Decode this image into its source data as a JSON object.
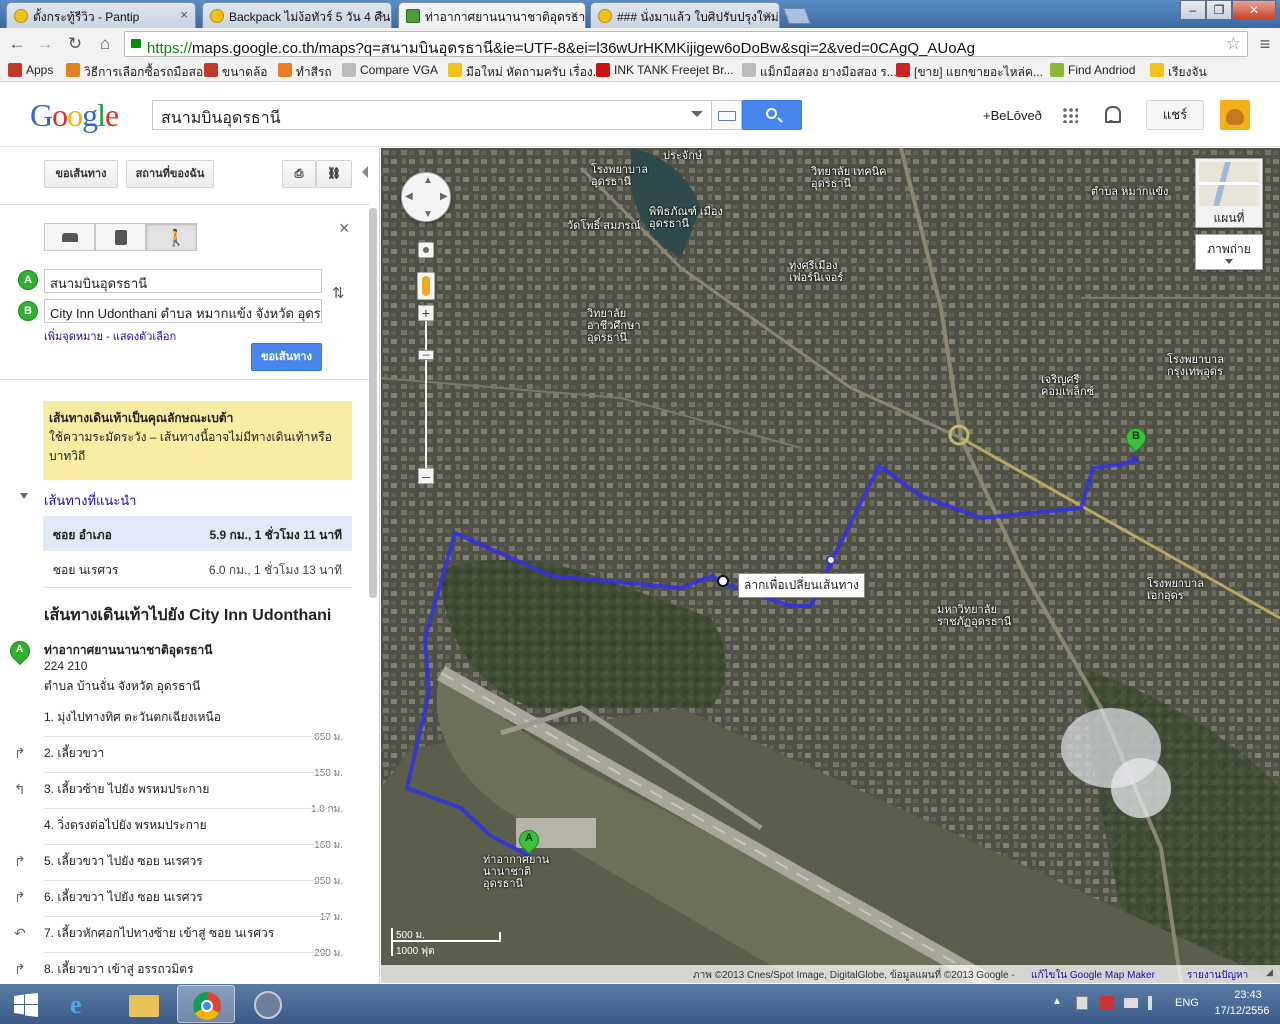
{
  "browser": {
    "tabs": [
      {
        "title": "ตั้งกระทู้รีวิว - Pantip"
      },
      {
        "title": "Backpack ไม่ง้อทัวร์ 5 วัน 4 คืน"
      },
      {
        "title": "ท่าอากาศยานนานาชาติอุดรธานี"
      },
      {
        "title": "### นั่งมาแล้ว ใบศิปรับปรุงใหม่"
      }
    ],
    "url_https": "https://",
    "url_rest": "maps.google.co.th/maps?q=สนามบินอุดรธานี&ie=UTF-8&ei=l36wUrHKMKijigew6oDoBw&sqi=2&ved=0CAgQ_AUoAg",
    "bookmarks": [
      {
        "label": "Apps",
        "color": "#c0392b"
      },
      {
        "label": "วิธีการเลือกซื้อรถมือสอง",
        "color": "#e67e22"
      },
      {
        "label": "ขนาดล้อ",
        "color": "#c0392b"
      },
      {
        "label": "ทำสีรถ",
        "color": "#e67e22"
      },
      {
        "label": "Compare VGA",
        "color": "#bbbbbb"
      },
      {
        "label": "มือใหม่ หัดถามครับ เรื่อง..",
        "color": "#f2c21a"
      },
      {
        "label": "INK TANK Freejet Br...",
        "color": "#cc1111"
      },
      {
        "label": "แม็กมือสอง ยางมือสอง ร...",
        "color": "#bbbbbb"
      },
      {
        "label": "[ขาย] แยกขายอะไหล่ค...",
        "color": "#cc2222"
      },
      {
        "label": "Find Andriod",
        "color": "#88bb33"
      },
      {
        "label": "เรียงจัน",
        "color": "#f2c21a"
      }
    ]
  },
  "header": {
    "logo": "Google",
    "search_value": "สนามบินอุดรธานี",
    "plus_user": "+BeLōveð",
    "share": "แชร์"
  },
  "panel": {
    "get_directions": "ขอเส้นทาง",
    "my_places": "สถานที่ของฉัน",
    "origin": "สนามบินอุดรธานี",
    "destination": "City Inn Udonthani ตำบล หมากแข้ง จังหวัด อุดรธานี",
    "add_dest": "เพิ่มจุดหมาย - แสดงตัวเลือก",
    "submit": "ขอเส้นทาง",
    "warn_title": "เส้นทางเดินเท้าเป็นคุณลักษณะเบต้า",
    "warn_body": "ใช้ความระมัดระวัง – เส้นทางนี้อาจไม่มีทางเดินเท้าหรือบาทวิถี",
    "suggested": "เส้นทางที่แนะนำ",
    "routes": [
      {
        "name": "ซอย อำเภอ",
        "info": "5.9 กม., 1 ชั่วโมง 11 นาที"
      },
      {
        "name": "ซอย นเรศวร",
        "info": "6.0 กม., 1 ชั่วโมง 13 นาที"
      }
    ],
    "walk_title": "เส้นทางเดินเท้าไปยัง City Inn Udonthani",
    "start_name": "ท่าอากาศยานนานาชาติอุดรธานี",
    "start_addr1": "224 210",
    "start_addr2": "ตำบล บ้านจั่น จังหวัด อุดรธานี",
    "steps": [
      {
        "text": "1. มุ่งไปทางทิศ ตะวันตกเฉียงเหนือ",
        "dist": "650 ม."
      },
      {
        "text": "2. เลี้ยวขวา",
        "dist": "150 ม."
      },
      {
        "text": "3. เลี้ยวซ้าย ไปยัง พรหมประกาย",
        "dist": "1.0 กม."
      },
      {
        "text": "4. วิ่งตรงต่อไปยัง พรหมประกาย",
        "dist": "160 ม."
      },
      {
        "text": "5. เลี้ยวขวา ไปยัง ซอย นเรศวร",
        "dist": "950 ม."
      },
      {
        "text": "6. เลี้ยวขวา ไปยัง ซอย นเรศวร",
        "dist": "17 ม."
      },
      {
        "text": "7. เลี้ยวหักศอกไปทางซ้าย เข้าสู่ ซอย นเรศวร",
        "dist": "290 ม."
      },
      {
        "text": "8. เลี้ยวขวา เข้าสู่ อรรถวมิตร",
        "dist": ""
      }
    ]
  },
  "map": {
    "drag_tip": "ลากเพื่อเปลี่ยนเส้นทาง",
    "map_label": "แผนที่",
    "sat_label": "ภาพถ่าย",
    "scale_m": "500 ม.",
    "scale_ft": "1000 ฟุต",
    "labels": [
      {
        "text": "ประจักษ์"
      },
      {
        "text": "โรงพยาบาล อุดรธานี"
      },
      {
        "text": "วิทยาลัย เทคนิคอุดรธานี"
      },
      {
        "text": "พิพิธภัณฑ์ เมืองอุดรธานี"
      },
      {
        "text": "วัดโพธิ์ สมภรณ์"
      },
      {
        "text": "ทุ่งศรีเมือง เฟอร์นิเจอร์"
      },
      {
        "text": "วิทยาลัย อาชีวศึกษา อุดรธานี"
      },
      {
        "text": "ตำบล หมากแข้ง"
      },
      {
        "text": "โรงพยาบาล กรุงเทพอุดร"
      },
      {
        "text": "เจริญศรี คอมเพล็กซ์"
      },
      {
        "text": "มหาวิทยาลัย ราชภัฏอุดรธานี"
      },
      {
        "text": "โรงพยาบาล เอกอุดร"
      },
      {
        "text": "ท่าอากาศยาน นานาชาติอุดรธานี"
      }
    ],
    "marker_a": "A",
    "marker_b": "B",
    "attribution": "ภาพ ©2013 Cnes/Spot Image, DigitalGlobe, ข้อมูลแผนที่ ©2013 Google -",
    "edit_link": "แก้ไขใน Google Map Maker",
    "report": "รายงานปัญหา"
  },
  "taskbar": {
    "lang": "ENG",
    "time": "23:43",
    "date": "17/12/2556"
  }
}
